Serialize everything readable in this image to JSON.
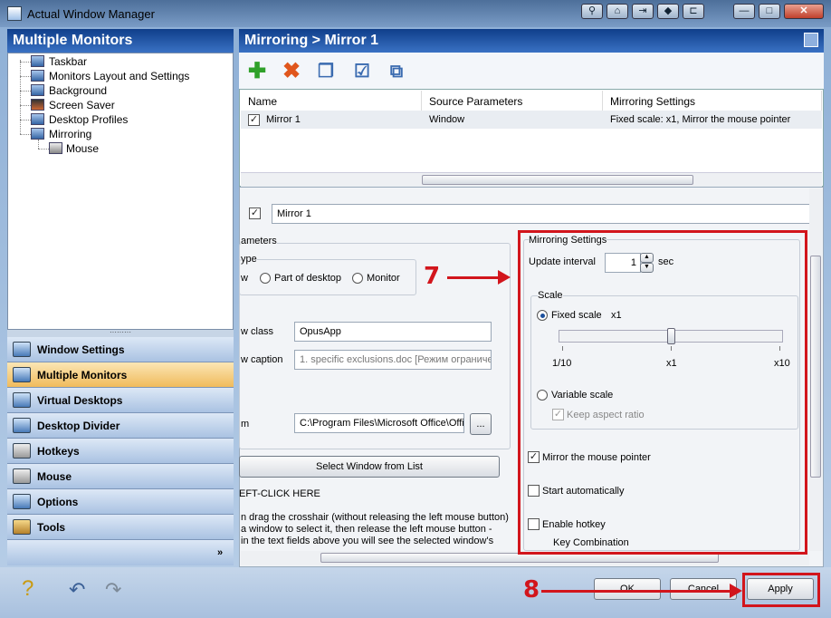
{
  "window": {
    "title": "Actual Window Manager",
    "controls": [
      "⚲",
      "⌂",
      "⇥",
      "◆",
      "⊏",
      "—",
      "□",
      "✕"
    ]
  },
  "left": {
    "header": "Multiple Monitors",
    "tree": [
      "Taskbar",
      "Monitors Layout and Settings",
      "Background",
      "Screen Saver",
      "Desktop Profiles",
      "Mirroring",
      "Mouse"
    ],
    "splitter": "·········",
    "nav": [
      "Window Settings",
      "Multiple Monitors",
      "Virtual Desktops",
      "Desktop Divider",
      "Hotkeys",
      "Mouse",
      "Options",
      "Tools"
    ],
    "nav_selected": "Multiple Monitors",
    "more": "»"
  },
  "right": {
    "header": "Mirroring > Mirror 1",
    "toolbar_icons": [
      "add-icon",
      "delete-icon",
      "copy-icon",
      "check-all-icon",
      "windows-icon"
    ],
    "grid": {
      "columns": [
        "Name",
        "Source Parameters",
        "Mirroring Settings"
      ],
      "rows": [
        {
          "checked": true,
          "name": "Mirror 1",
          "source": "Window",
          "settings": "Fixed scale: x1, Mirror the mouse pointer"
        }
      ]
    },
    "detail": {
      "name_value": "Mirror 1",
      "params_title": "ameters",
      "type_label": "ype",
      "type_w": "w",
      "opt_part": "Part of desktop",
      "opt_monitor": "Monitor",
      "class_label": "w class",
      "class_value": "OpusApp",
      "caption_label": "w caption",
      "caption_value": "1. specific exclusions.doc [Режим ограничен",
      "path_label": "m",
      "path_value": "C:\\Program Files\\Microsoft Office\\Offic",
      "browse": "...",
      "select_btn": "Select Window from List",
      "click_here": "EFT-CLICK HERE",
      "instr1": "n drag the crosshair (without releasing the left mouse button)",
      "instr2": "a window to select it, then release the left mouse button -",
      "instr3": "in the text fields above you will see the selected window's"
    },
    "mirroring": {
      "title": "Mirroring Settings",
      "update_label": "Update interval",
      "update_value": "1",
      "update_unit": "sec",
      "scale_title": "Scale",
      "fixed_label": "Fixed scale",
      "fixed_value": "x1",
      "scale_min": "1/10",
      "scale_mid": "x1",
      "scale_max": "x10",
      "variable_label": "Variable scale",
      "keep_aspect": "Keep aspect ratio",
      "mirror_pointer": "Mirror the mouse pointer",
      "start_auto": "Start automatically",
      "enable_hotkey": "Enable hotkey",
      "key_combination": "Key Combination",
      "scale_level": 0.5
    }
  },
  "bottom": {
    "ok": "OK",
    "cancel": "Cancel",
    "apply": "Apply"
  },
  "annotations": {
    "step7": "7",
    "step8": "8",
    "color": "#d2151c"
  }
}
